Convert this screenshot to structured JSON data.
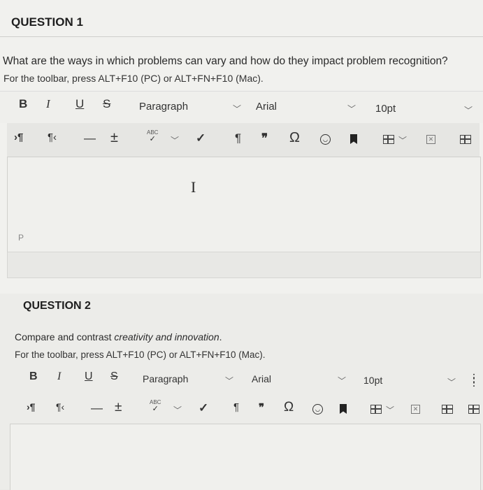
{
  "q1": {
    "title": "QUESTION 1",
    "prompt": "What are the ways in which problems can vary and how do they impact problem recognition?",
    "hint": "For the toolbar, press ALT+F10 (PC) or ALT+FN+F10 (Mac).",
    "toolbar": {
      "bold": "B",
      "italic": "I",
      "underline": "U",
      "strike": "S",
      "paragraph": "Paragraph",
      "font": "Arial",
      "size": "10pt"
    },
    "toolbar2": {
      "ltr": "›¶",
      "rtl": "¶‹",
      "hr": "—",
      "plusminus": "±",
      "spell": "ABC",
      "check": "✓",
      "pilcrow": "¶",
      "quote": "❞",
      "omega": "Ω"
    },
    "editor": {
      "cursor": "I",
      "path": "P"
    }
  },
  "q2": {
    "title": "QUESTION 2",
    "prompt_before": "Compare and contrast ",
    "prompt_italic": "creativity and innovation",
    "prompt_after": ".",
    "hint": "For the toolbar, press ALT+F10 (PC) or ALT+FN+F10 (Mac).",
    "toolbar": {
      "bold": "B",
      "italic": "I",
      "underline": "U",
      "strike": "S",
      "paragraph": "Paragraph",
      "font": "Arial",
      "size": "10pt"
    },
    "toolbar2": {
      "ltr": "›¶",
      "rtl": "¶‹",
      "hr": "—",
      "plusminus": "±",
      "spell": "ABC",
      "check": "✓",
      "pilcrow": "¶",
      "quote": "❞",
      "omega": "Ω"
    }
  }
}
